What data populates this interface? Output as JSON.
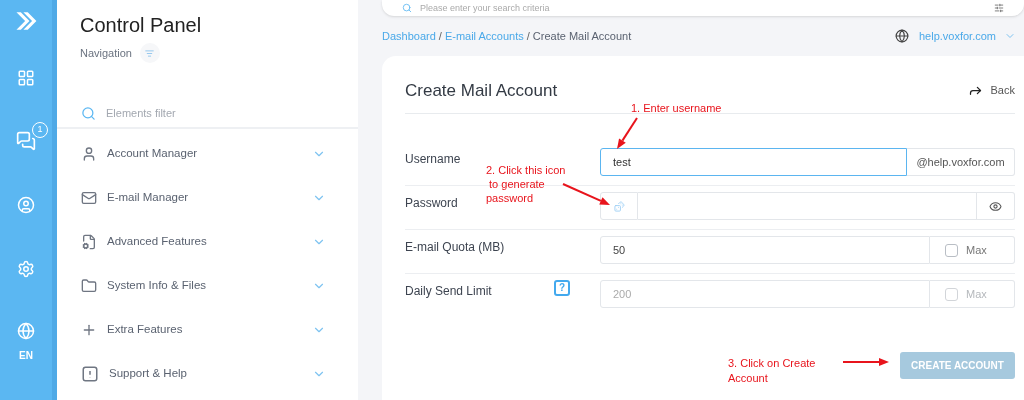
{
  "rail": {
    "badge": "1",
    "language": "EN"
  },
  "sidebar": {
    "title": "Control Panel",
    "subtitle": "Navigation",
    "filter_placeholder": "Elements filter",
    "items": [
      {
        "label": "Account Manager",
        "expanded": false
      },
      {
        "label": "E-mail Manager",
        "expanded": false
      },
      {
        "label": "Advanced Features",
        "expanded": false
      },
      {
        "label": "System Info & Files",
        "expanded": false
      },
      {
        "label": "Extra Features",
        "expanded": false
      },
      {
        "label": "Support & Help",
        "expanded": false
      }
    ]
  },
  "search": {
    "placeholder": "Please enter your search criteria"
  },
  "breadcrumb": [
    {
      "label": "Dashboard",
      "kind": "link"
    },
    {
      "separator": "/",
      "label": "E-mail Accounts",
      "kind": "link"
    },
    {
      "separator": "/",
      "label": "Create Mail Account",
      "kind": "current"
    }
  ],
  "domain": "help.voxfor.com",
  "form": {
    "title": "Create Mail Account",
    "back": "Back",
    "rows": [
      {
        "kind": "suffix",
        "label": "Username",
        "value": "test",
        "suffix": "@help.voxfor.com",
        "focused": true
      },
      {
        "kind": "password",
        "label": "Password",
        "value": ""
      },
      {
        "kind": "max",
        "label": "E-mail Quota (MB)",
        "value": "50",
        "max_label": "Max",
        "checked": false,
        "disabled": false
      },
      {
        "kind": "max",
        "label": "Daily Send Limit",
        "help": "?",
        "placeholder": "200",
        "max_label": "Max",
        "checked": false,
        "disabled": true
      }
    ],
    "submit": {
      "label": "CREATE ACCOUNT",
      "disabled": true
    }
  },
  "annotations": [
    "1. Enter username",
    "2. Click this icon\n to generate\npassword",
    "3. Click on Create\nAccount"
  ]
}
